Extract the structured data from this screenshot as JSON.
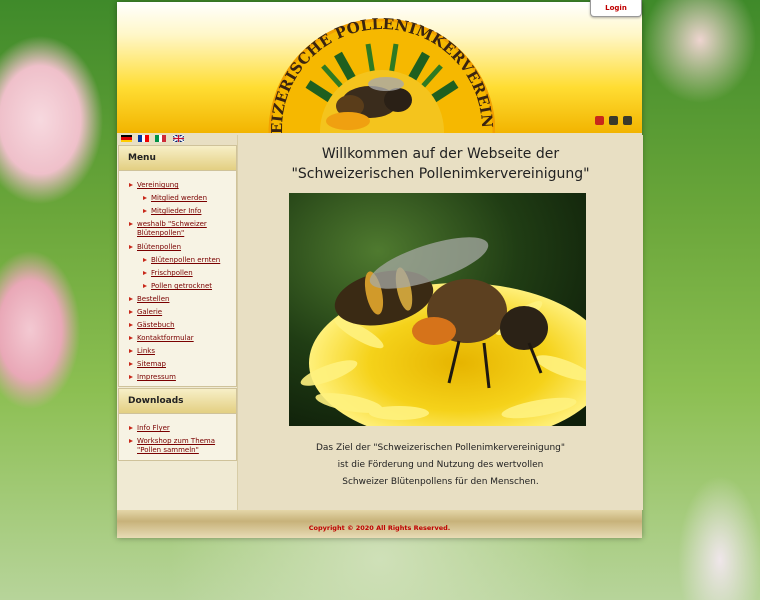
{
  "header": {
    "logo_text": "SCHWEIZERISCHE POLLENIMKERVEREINIGUNG",
    "login_label": "Login"
  },
  "languages": [
    "de",
    "fr",
    "it",
    "en"
  ],
  "menu": {
    "title": "Menu",
    "items": [
      {
        "label": "Vereinigung",
        "level": 0
      },
      {
        "label": "Mitglied werden",
        "level": 1
      },
      {
        "label": "Mitglieder Info",
        "level": 1
      },
      {
        "label": "weshalb \"Schweizer",
        "label2": "Blütenpollen\"",
        "level": 0
      },
      {
        "label": "Blütenpollen",
        "level": 0
      },
      {
        "label": "Blütenpollen ernten",
        "level": 1
      },
      {
        "label": "Frischpollen",
        "level": 1
      },
      {
        "label": "Pollen getrocknet",
        "level": 1
      },
      {
        "label": "Bestellen",
        "level": 0
      },
      {
        "label": "Galerie",
        "level": 0
      },
      {
        "label": "Gästebuch",
        "level": 0
      },
      {
        "label": "Kontaktformular",
        "level": 0
      },
      {
        "label": "Links",
        "level": 0
      },
      {
        "label": "Sitemap",
        "level": 0
      },
      {
        "label": "Impressum",
        "level": 0
      }
    ]
  },
  "downloads": {
    "title": "Downloads",
    "items": [
      {
        "label": "Info Flyer"
      },
      {
        "label": "Workshop zum Thema",
        "label2": "\"Pollen sammeln\""
      }
    ]
  },
  "main": {
    "welcome_line1": "Willkommen auf der Webseite der",
    "welcome_line2": "\"Schweizerischen Pollenimkervereinigung\"",
    "desc_line1": "Das Ziel der \"Schweizerischen Pollenimkervereinigung\"",
    "desc_line2": "ist die Förderung und Nutzung des wertvollen",
    "desc_line3": "Schweizer Blütenpollens für den Menschen."
  },
  "footer": {
    "copyright": "Copyright © 2020 All Rights Reserved."
  },
  "colors": {
    "accent_red": "#c00000",
    "header_yellow": "#ffdd33",
    "content_bg": "#e8dfc3"
  }
}
